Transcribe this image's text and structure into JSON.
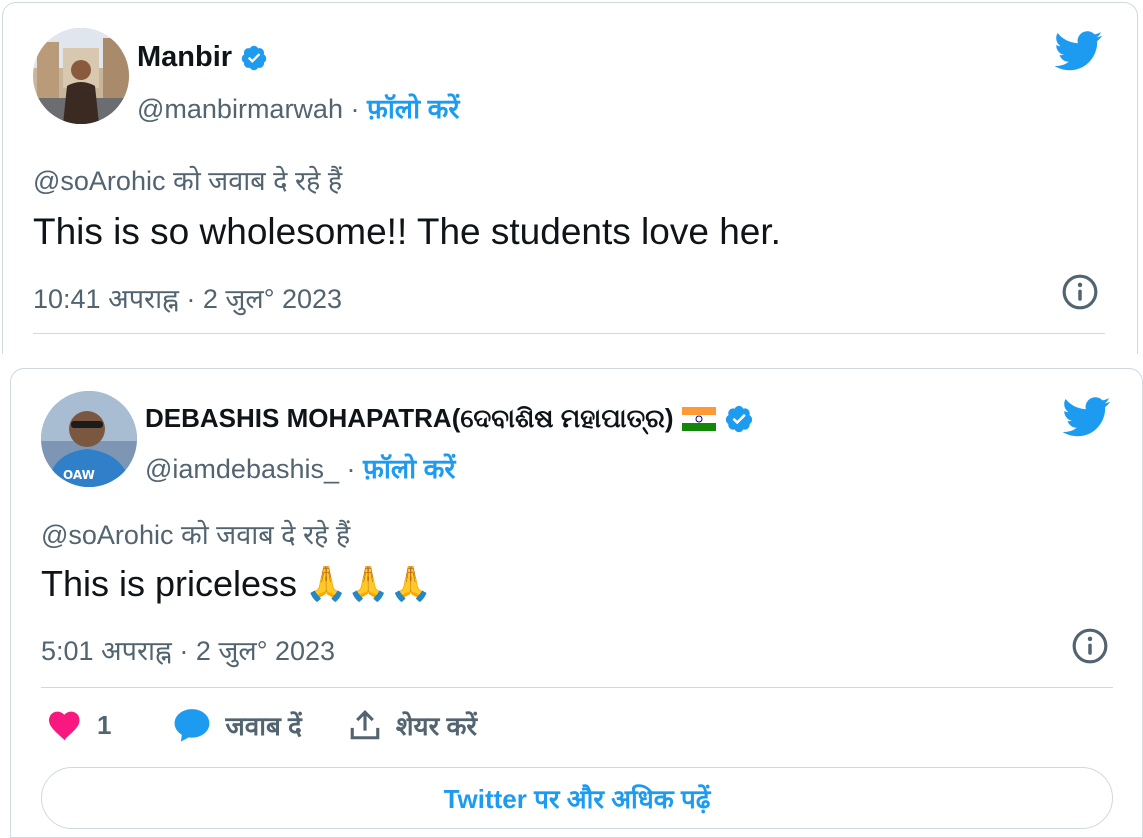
{
  "tweets": [
    {
      "name": "Manbir",
      "handle": "@manbirmarwah",
      "separator": "·",
      "follow": "फ़ॉलो करें",
      "reply_to": "@soArohic को जवाब दे रहे हैं",
      "text": "This is so wholesome!! The students love her.",
      "time": "10:41 अपराह्न · 2 जुल° 2023"
    },
    {
      "name": "DEBASHIS MOHAPATRA(ଦେବାଶିଷ ମହାପାତ୍ର)",
      "handle": "@iamdebashis_",
      "separator": "·",
      "follow": "फ़ॉलो करें",
      "reply_to": "@soArohic को जवाब दे रहे हैं",
      "text": "This is priceless",
      "emoji": "🙏🙏🙏",
      "time": "5:01 अपराह्न · 2 जुल° 2023",
      "actions": {
        "like_count": "1",
        "reply_label": "जवाब दें",
        "share_label": "शेयर करें"
      },
      "more_button": "Twitter पर और अधिक पढ़ें"
    }
  ],
  "colors": {
    "twitter_blue": "#1d9bf0",
    "heart": "#f91880",
    "text": "#0f1419",
    "muted": "#536471",
    "border": "#cfd9de"
  },
  "icons": [
    "verified-badge-icon",
    "twitter-bird-icon",
    "info-icon",
    "heart-icon",
    "reply-bubble-icon",
    "share-icon",
    "india-flag-icon"
  ]
}
